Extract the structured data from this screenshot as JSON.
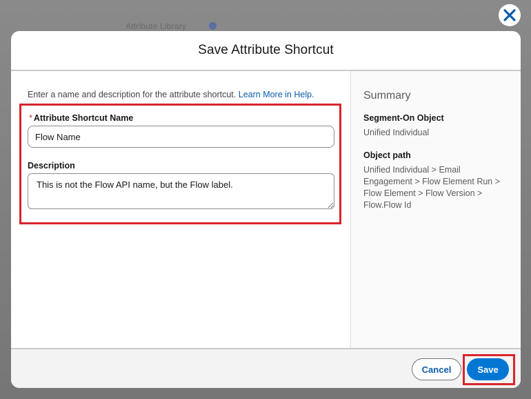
{
  "background": {
    "ghost_text": "Attribute Library"
  },
  "modal": {
    "title": "Save Attribute Shortcut",
    "close_icon": "close-icon",
    "intro_text": "Enter a name and description for the attribute shortcut.",
    "help_link": "Learn More in Help.",
    "name_field": {
      "required_marker": "*",
      "label": "Attribute Shortcut Name",
      "value": "Flow Name"
    },
    "description_field": {
      "label": "Description",
      "value": "This is not the Flow API name, but the Flow label."
    },
    "summary": {
      "title": "Summary",
      "segment_on_label": "Segment-On Object",
      "segment_on_value": "Unified Individual",
      "object_path_label": "Object path",
      "object_path_value": "Unified Individual > Email Engagement > Flow Element Run > Flow Element > Flow Version > Flow.Flow Id"
    },
    "footer": {
      "cancel_label": "Cancel",
      "save_label": "Save"
    }
  },
  "colors": {
    "brand": "#0176d3",
    "link": "#0b5cab",
    "highlight": "#d9242b",
    "required": "#c23934"
  }
}
